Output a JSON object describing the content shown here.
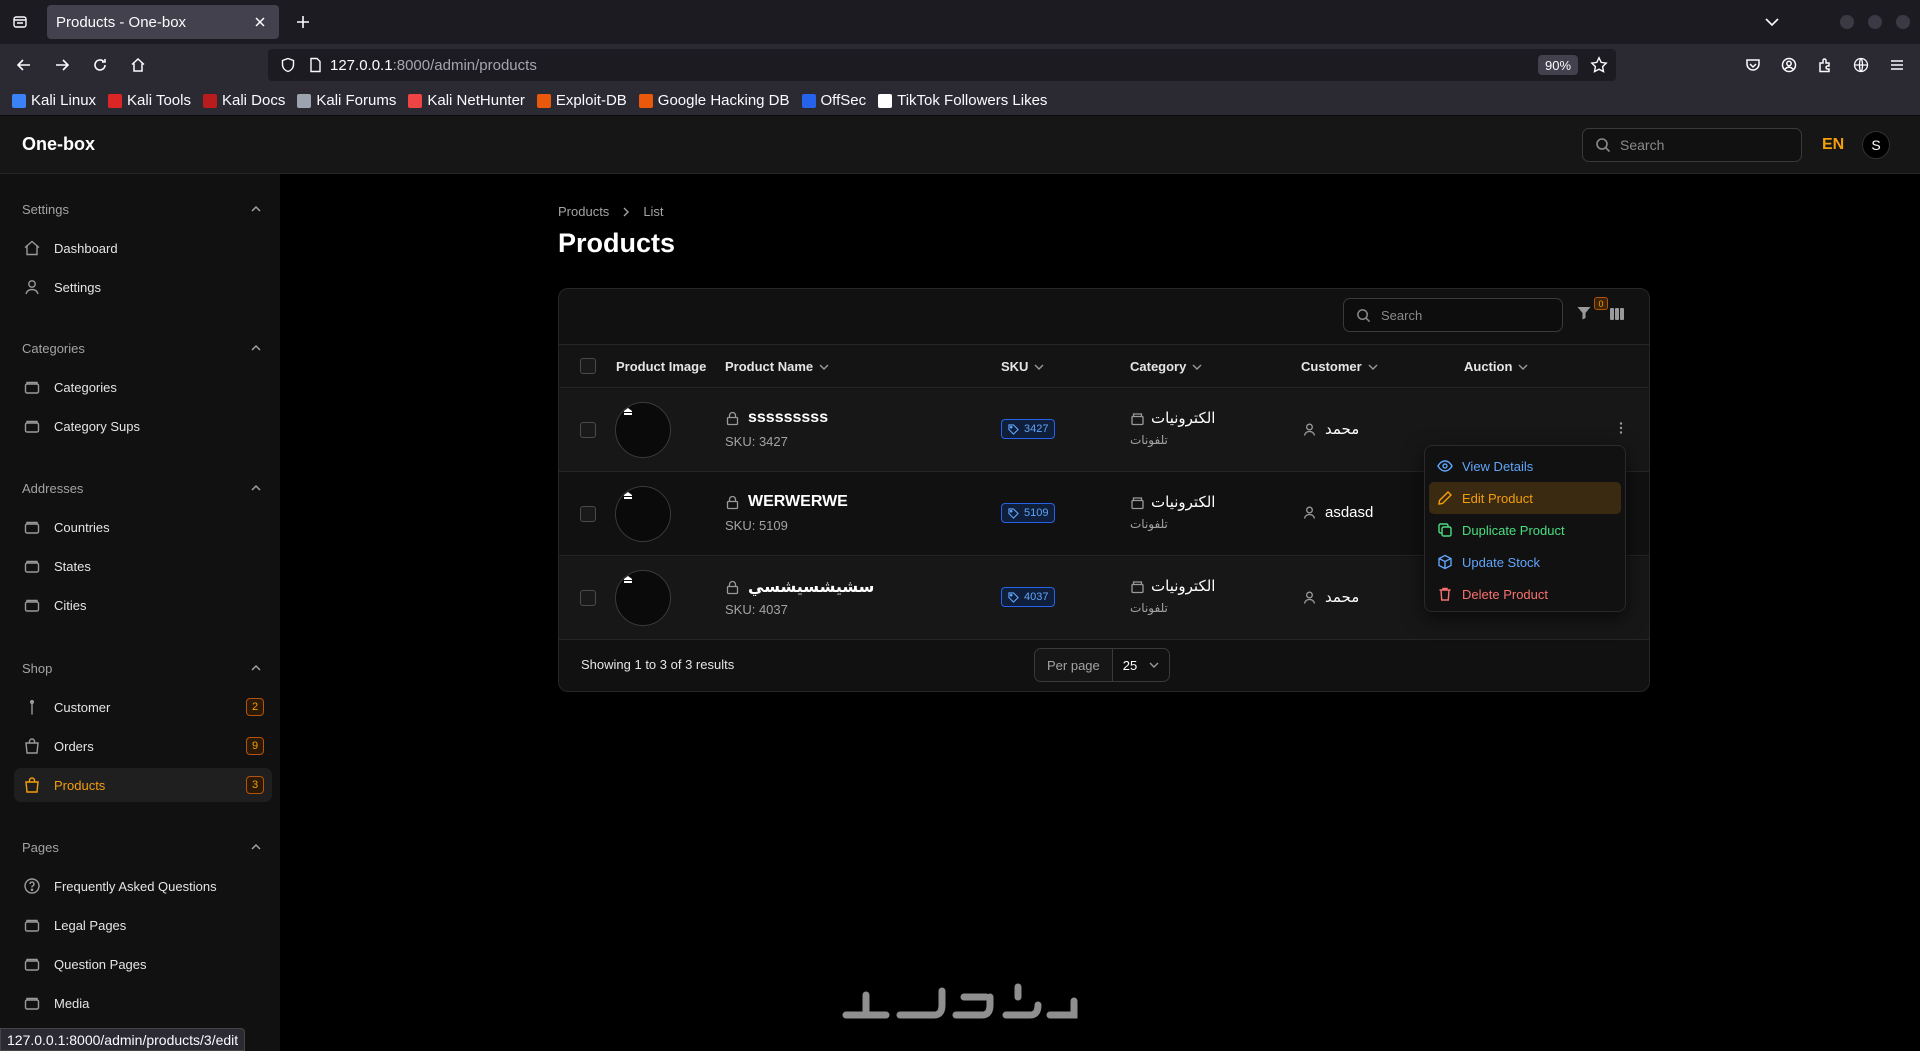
{
  "browser": {
    "tab_title": "Products - One-box",
    "url_host": "127.0.0.1",
    "url_rest": ":8000/admin/products",
    "zoom": "90%",
    "bookmarks": [
      "Kali Linux",
      "Kali Tools",
      "Kali Docs",
      "Kali Forums",
      "Kali NetHunter",
      "Exploit-DB",
      "Google Hacking DB",
      "OffSec",
      "TikTok Followers Likes"
    ],
    "status_url": "127.0.0.1:8000/admin/products/3/edit"
  },
  "header": {
    "brand": "One-box",
    "search_placeholder": "Search",
    "language": "EN",
    "avatar_initial": "S"
  },
  "sidebar": {
    "groups": [
      {
        "title": "Settings",
        "items": [
          {
            "label": "Dashboard",
            "icon": "home-icon"
          },
          {
            "label": "Settings",
            "icon": "user-icon"
          }
        ]
      },
      {
        "title": "Categories",
        "items": [
          {
            "label": "Categories",
            "icon": "box-icon"
          },
          {
            "label": "Category Sups",
            "icon": "box-icon"
          }
        ]
      },
      {
        "title": "Addresses",
        "items": [
          {
            "label": "Countries",
            "icon": "box-icon"
          },
          {
            "label": "States",
            "icon": "box-icon"
          },
          {
            "label": "Cities",
            "icon": "box-icon"
          }
        ]
      },
      {
        "title": "Shop",
        "items": [
          {
            "label": "Customer",
            "badge": "2"
          },
          {
            "label": "Orders",
            "badge": "9"
          },
          {
            "label": "Products",
            "badge": "3",
            "active": true
          }
        ]
      },
      {
        "title": "Pages",
        "items": [
          {
            "label": "Frequently Asked Questions"
          },
          {
            "label": "Legal Pages"
          },
          {
            "label": "Question Pages"
          },
          {
            "label": "Media"
          }
        ]
      }
    ]
  },
  "main": {
    "breadcrumb": [
      "Products",
      "List"
    ],
    "title": "Products"
  },
  "table": {
    "search_placeholder": "Search",
    "filter_count": "0",
    "columns": [
      "Product Image",
      "Product Name",
      "SKU",
      "Category",
      "Customer",
      "Auction"
    ],
    "rows": [
      {
        "name": "sssssssss",
        "sku_line": "SKU: 3427",
        "sku": "3427",
        "category": "الكترونيات",
        "subcategory": "تلفونات",
        "customer": "محمد"
      },
      {
        "name": "WERWERWE",
        "sku_line": "SKU: 5109",
        "sku": "5109",
        "category": "الكترونيات",
        "subcategory": "تلفونات",
        "customer": "asdasd"
      },
      {
        "name": "سشيشسيشسي",
        "sku_line": "SKU: 4037",
        "sku": "4037",
        "category": "الكترونيات",
        "subcategory": "تلفونات",
        "customer": "محمد"
      }
    ],
    "footer_text": "Showing 1 to 3 of 3 results",
    "per_page_label": "Per page",
    "per_page_value": "25"
  },
  "row_menu": {
    "items": [
      {
        "label": "View Details",
        "color": "#60a5fa"
      },
      {
        "label": "Edit Product",
        "color": "#f59e0b"
      },
      {
        "label": "Duplicate Product",
        "color": "#4ade80"
      },
      {
        "label": "Update Stock",
        "color": "#60a5fa"
      },
      {
        "label": "Delete Product",
        "color": "#f87171"
      }
    ]
  },
  "colors": {
    "accent": "#f59e0b",
    "background": "#000000",
    "panel": "#111111"
  }
}
